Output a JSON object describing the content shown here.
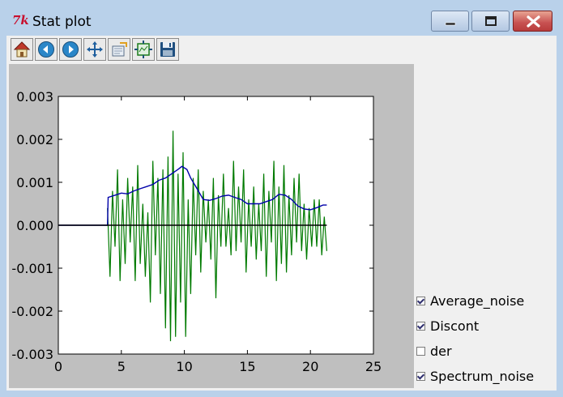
{
  "window": {
    "title": "Stat plot",
    "app_icon": "tk-feather-icon"
  },
  "titlebar_buttons": [
    {
      "name": "minimize-button",
      "icon": "minimize-icon"
    },
    {
      "name": "maximize-button",
      "icon": "maximize-icon"
    },
    {
      "name": "close-button",
      "icon": "close-icon"
    }
  ],
  "toolbar": [
    {
      "name": "home-button",
      "icon": "home-icon"
    },
    {
      "name": "back-button",
      "icon": "back-arrow-icon"
    },
    {
      "name": "forward-button",
      "icon": "forward-arrow-icon"
    },
    {
      "name": "pan-button",
      "icon": "move-arrows-icon"
    },
    {
      "name": "zoom-button",
      "icon": "zoom-rect-icon"
    },
    {
      "name": "configure-subplots-button",
      "icon": "subplots-icon"
    },
    {
      "name": "save-button",
      "icon": "floppy-disk-icon"
    }
  ],
  "checkboxes": [
    {
      "label": "Average_noise",
      "checked": true
    },
    {
      "label": "Discont",
      "checked": true
    },
    {
      "label": "der",
      "checked": false
    },
    {
      "label": "Spectrum_noise",
      "checked": true
    }
  ],
  "colors": {
    "average_noise": "#0000aa",
    "spectrum_noise": "#007a00",
    "discont": "#000000",
    "plot_bg": "#ffffff",
    "figure_bg": "#bfbfbf"
  },
  "chart_data": {
    "type": "line",
    "title": "",
    "xlabel": "",
    "ylabel": "",
    "xlim": [
      0,
      25
    ],
    "ylim": [
      -0.003,
      0.003
    ],
    "x_ticks": [
      0,
      5,
      10,
      15,
      20,
      25
    ],
    "x_tick_labels": [
      "0",
      "5",
      "10",
      "15",
      "20",
      "25"
    ],
    "y_ticks": [
      0.003,
      0.002,
      0.001,
      0.0,
      -0.001,
      -0.002,
      -0.003
    ],
    "y_tick_labels": [
      "0.003",
      "0.002",
      "0.001",
      "0.000",
      "-0.001",
      "-0.002",
      "-0.003"
    ],
    "grid": false,
    "series": [
      {
        "key": "spectrum_noise",
        "x": [
          3.9,
          4.1,
          4.3,
          4.5,
          4.7,
          4.9,
          5.1,
          5.3,
          5.5,
          5.7,
          5.9,
          6.1,
          6.3,
          6.5,
          6.7,
          6.9,
          7.1,
          7.3,
          7.5,
          7.7,
          7.9,
          8.1,
          8.3,
          8.5,
          8.7,
          8.9,
          9.1,
          9.3,
          9.5,
          9.7,
          9.9,
          10.1,
          10.3,
          10.5,
          10.7,
          10.9,
          11.1,
          11.3,
          11.5,
          11.7,
          11.9,
          12.1,
          12.3,
          12.5,
          12.7,
          12.9,
          13.1,
          13.3,
          13.5,
          13.7,
          13.9,
          14.1,
          14.3,
          14.5,
          14.7,
          14.9,
          15.1,
          15.3,
          15.5,
          15.7,
          15.9,
          16.1,
          16.3,
          16.5,
          16.7,
          16.9,
          17.1,
          17.3,
          17.5,
          17.7,
          17.9,
          18.1,
          18.3,
          18.5,
          18.7,
          18.9,
          19.1,
          19.3,
          19.5,
          19.7,
          19.9,
          20.1,
          20.3,
          20.5,
          20.7,
          20.9,
          21.1,
          21.3
        ],
        "y": [
          0.0004,
          -0.0012,
          0.0008,
          -0.0005,
          0.0013,
          -0.0013,
          0.0006,
          -0.0009,
          0.0011,
          -0.0004,
          0.0009,
          -0.0013,
          0.0014,
          -0.0009,
          0.0005,
          -0.0012,
          0.0003,
          -0.0018,
          0.0015,
          -0.0007,
          0.0011,
          -0.0016,
          0.0013,
          -0.0024,
          0.0016,
          -0.0027,
          0.0022,
          -0.0026,
          0.0012,
          -0.0018,
          0.0017,
          -0.0026,
          0.0006,
          -0.0016,
          0.0011,
          -0.0007,
          0.0013,
          -0.0011,
          0.0008,
          -0.0004,
          0.0006,
          -0.0008,
          0.0011,
          -0.0017,
          0.0007,
          -0.0005,
          0.0012,
          -0.0005,
          0.0004,
          -0.0007,
          0.0015,
          -0.0006,
          0.0009,
          -0.0004,
          0.0013,
          -0.0011,
          0.0006,
          -0.0005,
          0.0009,
          -0.0008,
          0.0005,
          -0.0006,
          0.0012,
          -0.0012,
          0.0008,
          -0.0004,
          0.0015,
          -0.0013,
          0.0009,
          -0.0009,
          0.0014,
          -0.0011,
          0.0007,
          -0.0007,
          0.0011,
          -0.0004,
          0.0012,
          -0.0006,
          0.0005,
          -0.0008,
          0.0004,
          -0.0005,
          0.0006,
          -0.0005,
          0.0006,
          -0.0007,
          0.0002,
          -0.0006
        ]
      },
      {
        "key": "average_noise",
        "x": [
          0.0,
          3.9,
          3.95,
          4.5,
          5.0,
          5.5,
          6.0,
          6.5,
          7.0,
          7.5,
          8.0,
          8.5,
          9.0,
          9.5,
          9.8,
          10.2,
          10.5,
          11.0,
          11.5,
          12.0,
          12.5,
          13.0,
          13.5,
          14.0,
          14.5,
          15.0,
          15.5,
          16.0,
          16.5,
          17.0,
          17.5,
          18.0,
          18.5,
          19.0,
          19.5,
          20.0,
          20.5,
          21.0,
          21.3
        ],
        "y": [
          0.0,
          0.0,
          0.00065,
          0.0007,
          0.00075,
          0.00073,
          0.0008,
          0.00085,
          0.0009,
          0.00095,
          0.00105,
          0.0011,
          0.0012,
          0.0013,
          0.00137,
          0.0013,
          0.0011,
          0.00085,
          0.0006,
          0.00058,
          0.00062,
          0.00068,
          0.0007,
          0.00065,
          0.0006,
          0.0005,
          0.0005,
          0.0005,
          0.00055,
          0.0006,
          0.00072,
          0.0007,
          0.0006,
          0.00045,
          0.00038,
          0.00036,
          0.00041,
          0.00047,
          0.00047
        ]
      },
      {
        "key": "discont",
        "x": [
          0,
          21.3
        ],
        "y": [
          0,
          0
        ]
      }
    ]
  }
}
